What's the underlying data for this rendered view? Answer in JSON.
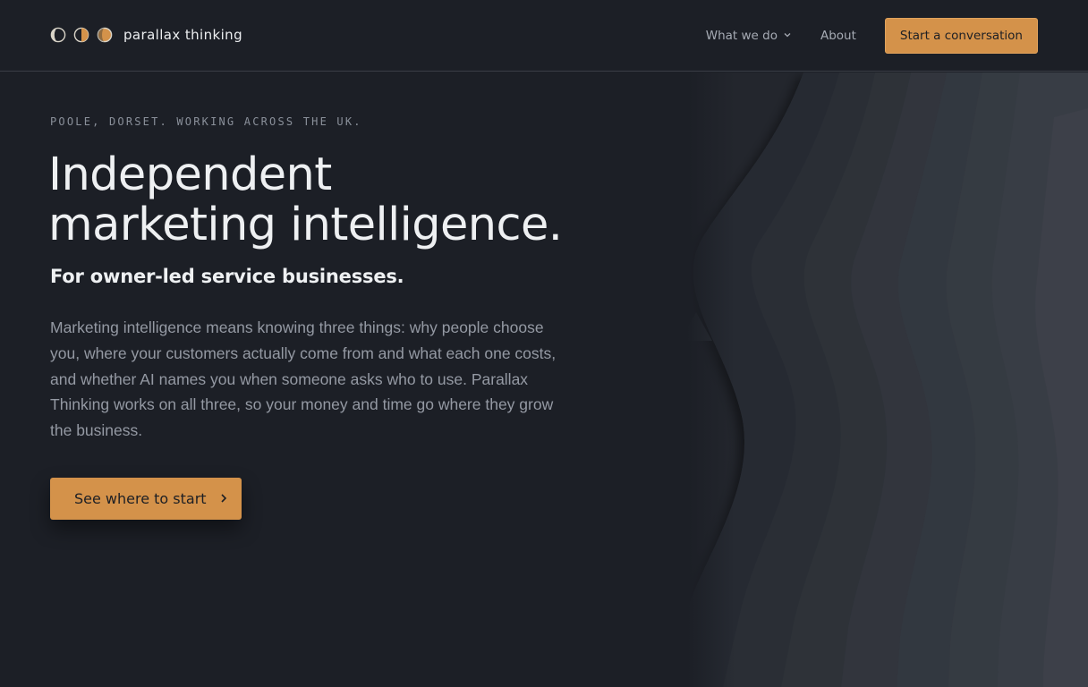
{
  "brand": {
    "name": "parallax thinking",
    "logo_icons": [
      "moon-phase-first-quarter-icon",
      "moon-phase-half-icon",
      "moon-phase-full-icon"
    ],
    "accent_color": "#d4924a"
  },
  "nav": {
    "items": [
      {
        "label": "What we do",
        "has_dropdown": true
      },
      {
        "label": "About",
        "has_dropdown": false
      }
    ],
    "cta_label": "Start a conversation"
  },
  "hero": {
    "eyebrow": "POOLE, DORSET. WORKING ACROSS THE UK.",
    "headline_line1": "Independent",
    "headline_line2": "marketing intelligence.",
    "subheadline": "For owner-led service businesses.",
    "body": "Marketing intelligence means knowing three things: why people choose you, where your customers actually come from and what each one costs, and whether AI names you when someone asks who to use. Parallax Thinking works on all three, so your money and time go where they grow the business.",
    "cta_label": "See where to start"
  },
  "colors": {
    "background": "#1c1f26",
    "text_primary": "#eef0f2",
    "text_muted": "#9499a3"
  }
}
